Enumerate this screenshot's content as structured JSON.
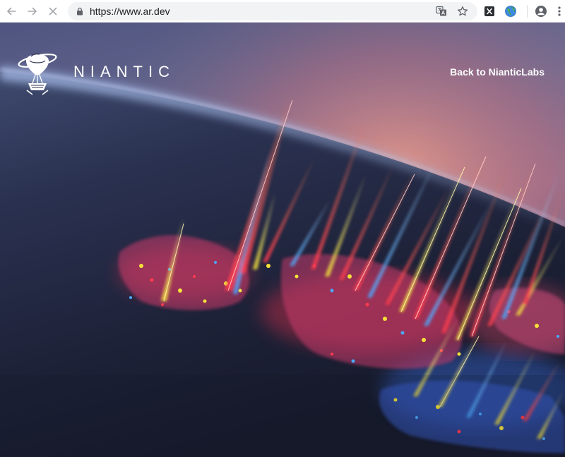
{
  "browser": {
    "url": "https://www.ar.dev",
    "toolbar_icons": [
      "back-arrow-icon",
      "forward-arrow-icon",
      "stop-loading-icon",
      "lock-icon",
      "translate-icon",
      "star-icon",
      "extension-x-icon",
      "extension-globe-icon",
      "profile-icon",
      "menu-dots-icon"
    ]
  },
  "header": {
    "brand": "NIANTIC",
    "back_link": "Back to NianticLabs"
  },
  "colors": {
    "accent_red": "#ff3b4e",
    "accent_yellow": "#f5e23a",
    "accent_blue": "#4aa8ff",
    "sky_top": "#4a4f78",
    "atmosphere_glow": "#e88a8c"
  }
}
